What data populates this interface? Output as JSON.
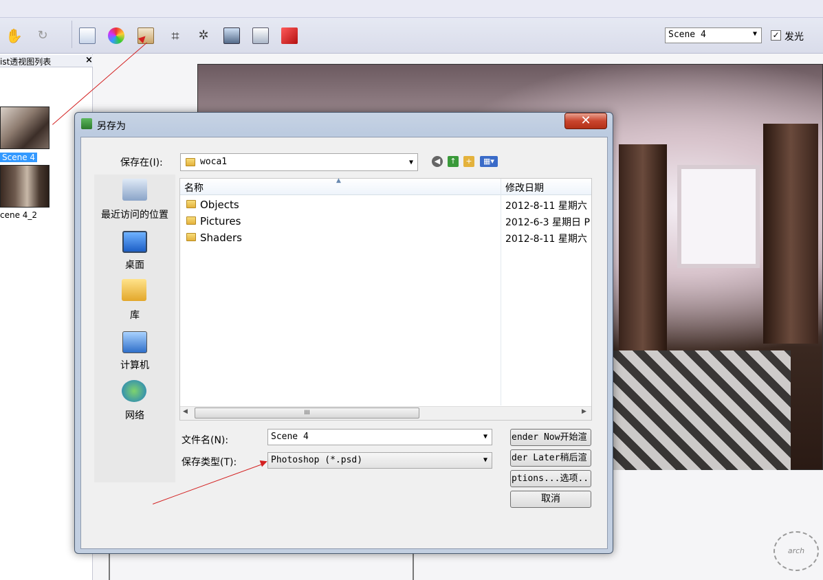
{
  "toolbar": {
    "scene_select_value": "Scene 4",
    "glow_checked": "✓",
    "glow_label": "发光"
  },
  "left_panel": {
    "title": "ist透视图列表",
    "close": "×",
    "thumbnails": [
      {
        "label": "Scene 4"
      },
      {
        "label": "cene 4_2"
      }
    ]
  },
  "dialog": {
    "title": "另存为",
    "close": "✕",
    "save_in_label": "保存在(I):",
    "save_in_value": "woca1",
    "places": [
      {
        "label": "最近访问的位置",
        "icon": "recent-places-icon"
      },
      {
        "label": "桌面",
        "icon": "desktop-icon"
      },
      {
        "label": "库",
        "icon": "libraries-icon"
      },
      {
        "label": "计算机",
        "icon": "computer-icon"
      },
      {
        "label": "网络",
        "icon": "network-icon"
      }
    ],
    "columns": {
      "name": "名称",
      "date": "修改日期"
    },
    "files": [
      {
        "name": "Objects",
        "date": "2012-8-11 星期六"
      },
      {
        "name": "Pictures",
        "date": "2012-6-3 星期日 P"
      },
      {
        "name": "Shaders",
        "date": "2012-8-11 星期六"
      }
    ],
    "scroll_grip": "III",
    "filename_label": "文件名(N):",
    "filename_value": "Scene 4",
    "filetype_label": "保存类型(T):",
    "filetype_value": "Photoshop (*.psd)",
    "buttons": {
      "render_now": "ender Now开始渲",
      "render_later": "der Later稍后渲",
      "options": "ptions...选项..",
      "cancel": "取消"
    }
  },
  "colors": {
    "selection": "#3399ff",
    "annotation_arrow": "#d32020",
    "dialog_frame": "#bccbe0"
  }
}
